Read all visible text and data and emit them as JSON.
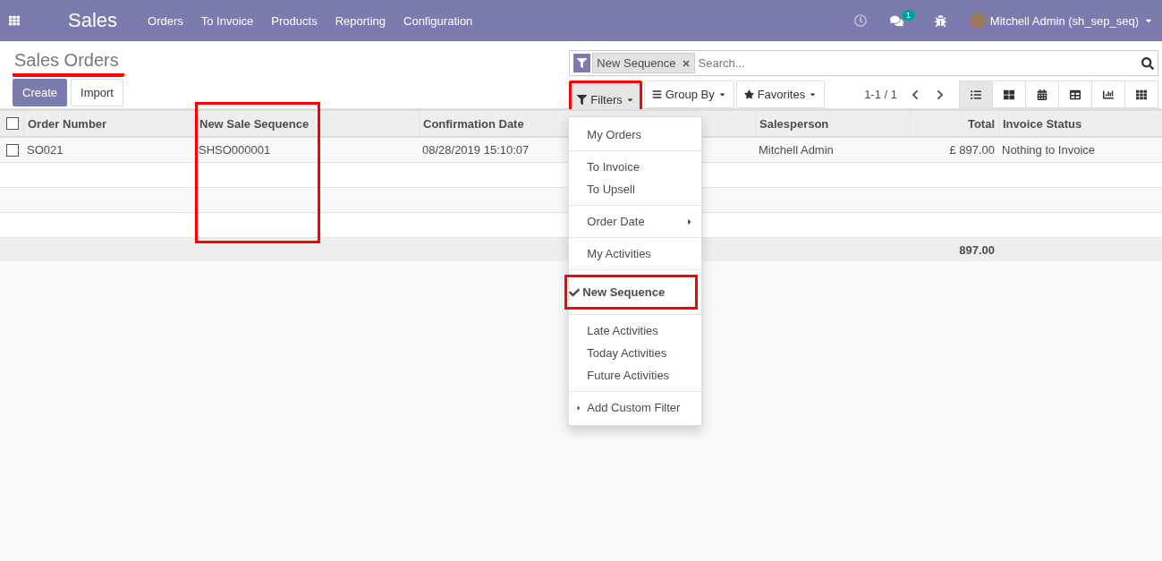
{
  "navbar": {
    "app": "Sales",
    "menu": [
      "Orders",
      "To Invoice",
      "Products",
      "Reporting",
      "Configuration"
    ],
    "chat_badge": "1",
    "user": "Mitchell Admin (sh_sep_seq)"
  },
  "title": {
    "text": "Sales Orders",
    "highlighted": true
  },
  "actions": [
    {
      "label": "Create",
      "kind": "primary"
    },
    {
      "label": "Import",
      "kind": "secondary"
    }
  ],
  "search": {
    "facet": "New Sequence",
    "placeholder": "Search..."
  },
  "search_buttons": [
    {
      "label": "Filters",
      "kind": "filter",
      "expanded": true,
      "highlighted": true
    },
    {
      "label": "Group By",
      "kind": "group",
      "expanded": false,
      "highlighted": false
    },
    {
      "label": "Favorites",
      "kind": "favorite",
      "expanded": false,
      "highlighted": false
    }
  ],
  "pager": "1-1 / 1",
  "views": [
    {
      "kind": "list",
      "selected": true
    },
    {
      "kind": "kanban",
      "selected": false
    },
    {
      "kind": "calendar",
      "selected": false
    },
    {
      "kind": "pivot",
      "selected": false
    },
    {
      "kind": "graph",
      "selected": false
    },
    {
      "kind": "activity",
      "selected": false
    }
  ],
  "filters_menu": [
    [
      {
        "label": "My Orders",
        "kind": "filter",
        "checked": false,
        "highlighted": false
      }
    ],
    [
      {
        "label": "To Invoice",
        "kind": "filter",
        "checked": false,
        "highlighted": false
      },
      {
        "label": "To Upsell",
        "kind": "filter",
        "checked": false,
        "highlighted": false
      }
    ],
    [
      {
        "label": "Order Date",
        "kind": "submenu",
        "checked": false,
        "highlighted": false
      }
    ],
    [
      {
        "label": "My Activities",
        "kind": "filter",
        "checked": false,
        "highlighted": false
      }
    ],
    [
      {
        "label": "New Sequence",
        "kind": "filter",
        "checked": true,
        "highlighted": true
      }
    ],
    [
      {
        "label": "Late Activities",
        "kind": "filter",
        "checked": false,
        "highlighted": false
      },
      {
        "label": "Today Activities",
        "kind": "filter",
        "checked": false,
        "highlighted": false
      },
      {
        "label": "Future Activities",
        "kind": "filter",
        "checked": false,
        "highlighted": false
      }
    ],
    [
      {
        "label": "Add Custom Filter",
        "kind": "custom",
        "checked": false,
        "highlighted": false
      }
    ]
  ],
  "table": {
    "select_all": {
      "checked": false
    },
    "columns": [
      {
        "label": "Order Number",
        "kind": "text",
        "highlighted": false
      },
      {
        "label": "New Sale Sequence",
        "kind": "text",
        "highlighted": true
      },
      {
        "label": "Confirmation Date",
        "kind": "text",
        "highlighted": false
      },
      {
        "label": "Salesperson",
        "kind": "text",
        "highlighted": false
      },
      {
        "label": "Total",
        "kind": "amount",
        "highlighted": false
      },
      {
        "label": "Invoice Status",
        "kind": "text",
        "highlighted": false
      }
    ],
    "rows": [
      {
        "checked": false,
        "cells": [
          "SO021",
          "SHSO000001",
          "08/28/2019 15:10:07",
          "Mitchell Admin",
          "£ 897.00",
          "Nothing to Invoice"
        ]
      }
    ],
    "total": "897.00"
  }
}
